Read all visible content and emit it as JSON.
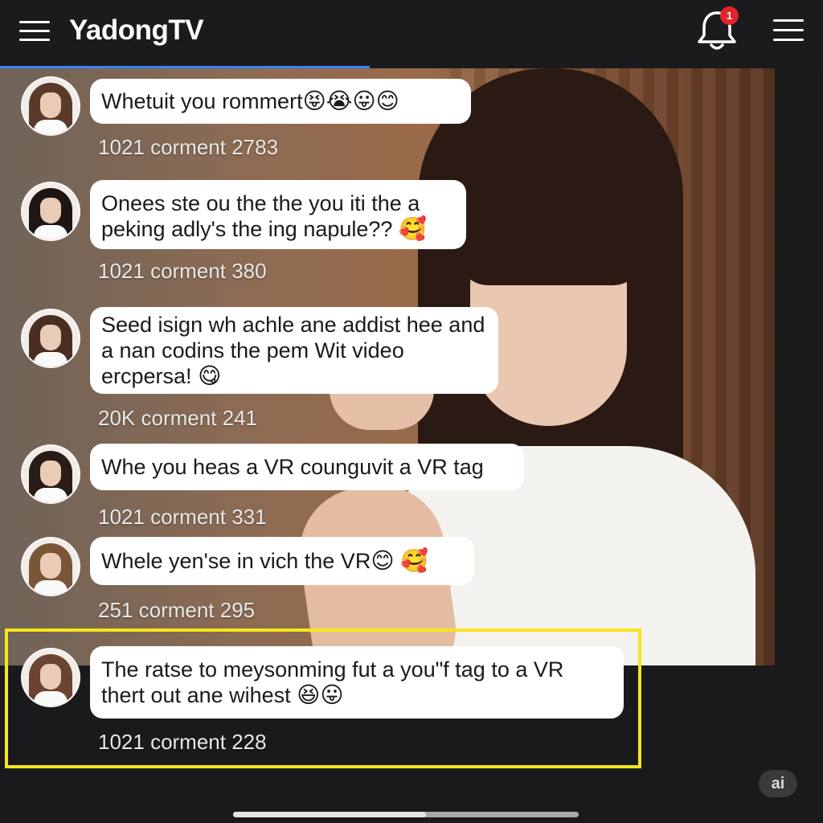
{
  "app": {
    "logo": "YadongTV",
    "notification_badge": "1",
    "ai_badge": "ai",
    "accent_color": "#3b82f6",
    "highlight_color": "#f5e61a",
    "badge_color": "#e0242c"
  },
  "icons": {
    "menu_left": "hamburger-menu-icon",
    "bell": "bell-icon",
    "menu_right": "hamburger-menu-icon"
  },
  "comments": [
    {
      "text": "Whetuit you rommert ",
      "emojis": "😝😭😛😊",
      "meta": "1021 corment 2783"
    },
    {
      "text": "Onees ste ou the the you iti the a peking adly's the ing napule?? ",
      "emojis": "🥰",
      "meta": "1021 corment 380"
    },
    {
      "text": "Seed isign wh achle ane addist hee and a nan codins the pem Wit video ercpersa! ",
      "emojis": "😋",
      "meta": "20K corment 241"
    },
    {
      "text": "Whe you heas a VR counguvit a VR tag",
      "emojis": "",
      "meta": "1021 corment  331"
    },
    {
      "text": "Whele yen'se in vich the VR ",
      "emojis": "😊 🥰",
      "meta": "251  corment 295"
    },
    {
      "text": "The ratse  to meysonming fut a you\"f tag to a VR thert out ane wihest ",
      "emojis": "😆😛",
      "meta": "1021 corment 228"
    }
  ]
}
